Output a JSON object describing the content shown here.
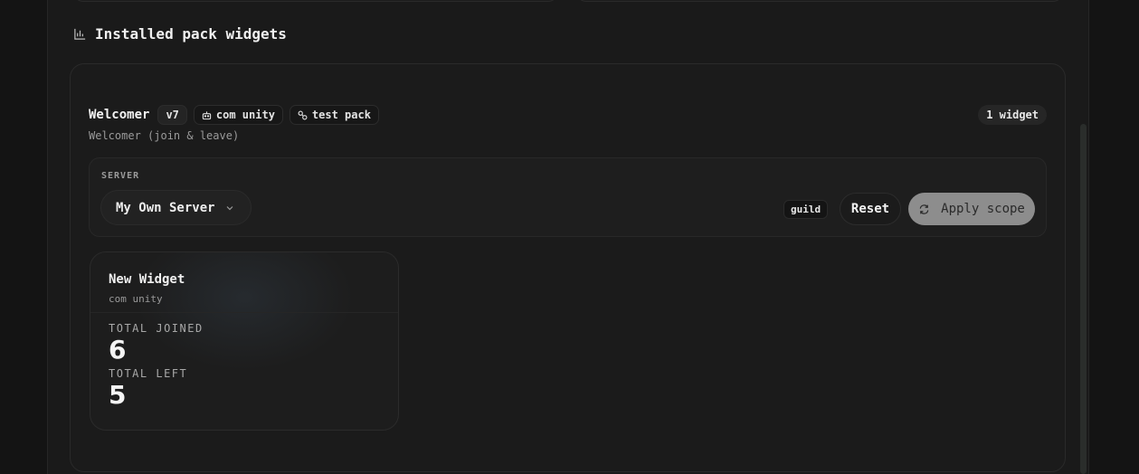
{
  "section": {
    "title": "Installed pack widgets",
    "icon": "bar-chart-icon"
  },
  "pack": {
    "name": "Welcomer",
    "version": "v7",
    "author": "com unity",
    "author_icon": "robot-icon",
    "pack_tag": "test pack",
    "pack_tag_icon": "link-icon",
    "subtitle": "Welcomer (join & leave)",
    "widget_count": "1 widget"
  },
  "server_panel": {
    "label": "SERVER",
    "selected": "My Own Server",
    "scope_tag": "guild",
    "reset_label": "Reset",
    "apply_label": "Apply scope",
    "apply_icon": "refresh-icon"
  },
  "widget": {
    "title": "New Widget",
    "subtitle": "com unity",
    "stats": [
      {
        "label": "TOTAL JOINED",
        "value": "6"
      },
      {
        "label": "TOTAL LEFT",
        "value": "5"
      }
    ]
  }
}
